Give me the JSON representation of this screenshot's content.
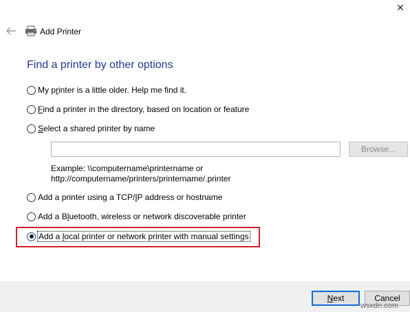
{
  "window": {
    "close_glyph": "✕"
  },
  "header": {
    "title": "Add Printer",
    "back_icon": "back-arrow-icon",
    "printer_icon": "printer-icon"
  },
  "heading": "Find a printer by other options",
  "options": [
    {
      "pre": "My p",
      "key": "r",
      "post": "inter is a little older. Help me find it.",
      "checked": false
    },
    {
      "pre": "",
      "key": "F",
      "post": "ind a printer in the directory, based on location or feature",
      "checked": false
    },
    {
      "pre": "",
      "key": "S",
      "post": "elect a shared printer by name",
      "checked": false
    },
    {
      "pre": "Add a printer using a TCP/",
      "key": "I",
      "post": "P address or hostname",
      "checked": false
    },
    {
      "pre": "Add a B",
      "key": "l",
      "post": "uetooth, wireless or network discoverable printer",
      "checked": false
    },
    {
      "pre": "Add a ",
      "key": "l",
      "post": "ocal printer or network printer with manual settings",
      "checked": true
    }
  ],
  "shared_input": {
    "value": ""
  },
  "browse_label": "Browse...",
  "example_line1": "Example: \\\\computername\\printername or",
  "example_line2": "http://computername/printers/printername/.printer",
  "footer": {
    "next_pre": "",
    "next_key": "N",
    "next_post": "ext",
    "cancel_label": "Cancel"
  },
  "watermark": "wsxdn.com",
  "colors": {
    "heading": "#1e3a8a",
    "highlight": "#d21f2b",
    "focus_border": "#0f6ad7"
  }
}
